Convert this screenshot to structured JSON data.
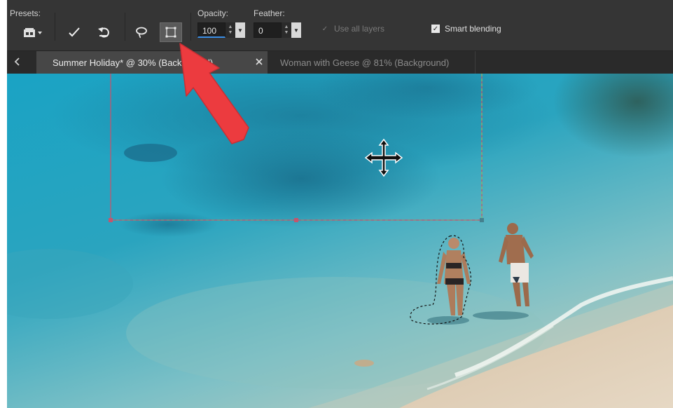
{
  "toolbar": {
    "presets_label": "Presets:",
    "opacity_label": "Opacity:",
    "opacity_value": "100",
    "feather_label": "Feather:",
    "feather_value": "0",
    "use_all_layers_label": "Use all layers",
    "use_all_layers_checked": true,
    "use_all_layers_enabled": false,
    "smart_blending_label": "Smart blending",
    "smart_blending_checked": true
  },
  "tabs": [
    {
      "label": "Summer Holiday* @  30% (Background)",
      "active": true
    },
    {
      "label": "Woman with Geese @  81% (Background)",
      "active": false
    }
  ],
  "colors": {
    "toolbar_bg": "#353535",
    "tabbar_bg": "#2a2a2a",
    "selection_box": "#c2566e",
    "annotation_arrow": "#ec3b3f",
    "opacity_underline": "#3a8ee6"
  },
  "icons": {
    "presets": "presets-icon",
    "commit": "checkmark-icon",
    "reset": "undo-icon",
    "freehand": "lasso-icon",
    "rectangle": "rectangle-select-icon",
    "tab_scroll": "chevron-left-icon",
    "tab_close": "close-icon",
    "move_cursor": "move-cursor-icon",
    "annotation": "red-arrow-annotation"
  }
}
